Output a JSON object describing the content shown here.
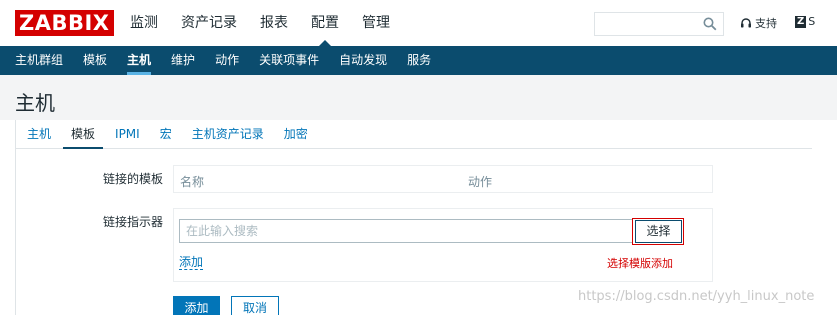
{
  "logo": "ZABBIX",
  "top_menu": [
    {
      "label": "监测"
    },
    {
      "label": "资产记录"
    },
    {
      "label": "报表"
    },
    {
      "label": "配置",
      "active": true
    },
    {
      "label": "管理"
    }
  ],
  "search": {
    "value": "",
    "placeholder": ""
  },
  "support_label": "支持",
  "share_label": "S",
  "sub_menu": [
    {
      "label": "主机群组"
    },
    {
      "label": "模板"
    },
    {
      "label": "主机",
      "active": true
    },
    {
      "label": "维护"
    },
    {
      "label": "动作"
    },
    {
      "label": "关联项事件"
    },
    {
      "label": "自动发现"
    },
    {
      "label": "服务"
    }
  ],
  "page_title": "主机",
  "tabs": [
    {
      "label": "主机"
    },
    {
      "label": "模板",
      "active": true
    },
    {
      "label": "IPMI"
    },
    {
      "label": "宏"
    },
    {
      "label": "主机资产记录"
    },
    {
      "label": "加密"
    }
  ],
  "form": {
    "linked_templates_label": "链接的模板",
    "linked_table": {
      "col_name": "名称",
      "col_action": "动作"
    },
    "link_indicator_label": "链接指示器",
    "search_placeholder": "在此输入搜索",
    "select_button": "选择",
    "add_link": "添加",
    "annotation": "选择模版添加"
  },
  "buttons": {
    "add": "添加",
    "cancel": "取消"
  },
  "watermark": "https://blog.csdn.net/yyh_linux_note",
  "colors": {
    "brand": "#d40000",
    "nav": "#0b4c6e",
    "link": "#0275b8",
    "accent": "#5ab3e5"
  }
}
